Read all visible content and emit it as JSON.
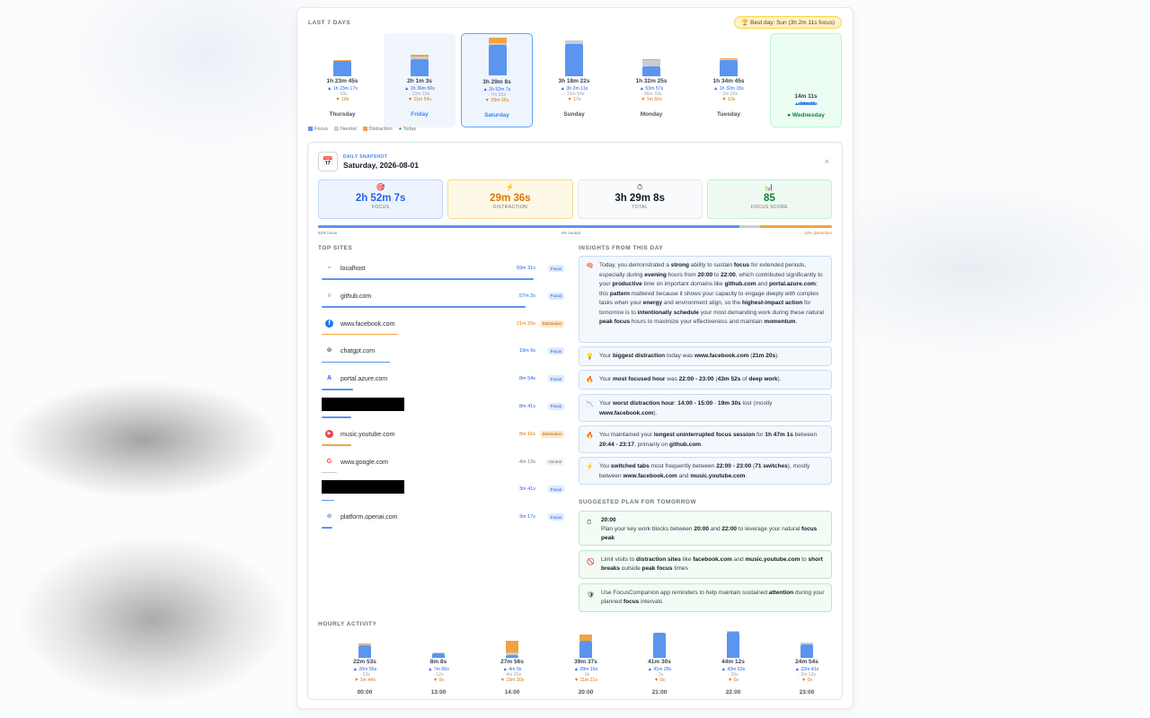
{
  "header": {
    "label": "LAST 7 DAYS",
    "best_day": "Best day: Sun (3h 2m 11s focus)"
  },
  "days": [
    {
      "name": "Thursday",
      "total": "1h 23m 45s",
      "focus": "1h 23m 17s",
      "neutral": "10s",
      "distraction": "18s",
      "f": 83,
      "n": 0.2,
      "d": 0.3,
      "state": "normal"
    },
    {
      "name": "Friday",
      "total": "2h 1m 3s",
      "focus": "1h 36m 50s",
      "neutral": "12m 19s",
      "distraction": "11m 54s",
      "f": 97,
      "n": 12,
      "d": 12,
      "state": "hover"
    },
    {
      "name": "Saturday",
      "total": "3h 29m 8s",
      "focus": "2h 52m 7s",
      "neutral": "7m 25s",
      "distraction": "29m 36s",
      "f": 172,
      "n": 7,
      "d": 30,
      "state": "selected"
    },
    {
      "name": "Sunday",
      "total": "3h 18m 22s",
      "focus": "3h 2m 11s",
      "neutral": "15m 54s",
      "distraction": "17s",
      "f": 182,
      "n": 16,
      "d": 0.3,
      "state": "normal"
    },
    {
      "name": "Monday",
      "total": "1h 32m 25s",
      "focus": "53m 57s",
      "neutral": "36m 33s",
      "distraction": "1m 55s",
      "f": 54,
      "n": 37,
      "d": 2,
      "state": "normal"
    },
    {
      "name": "Tuesday",
      "total": "1h 34m 45s",
      "focus": "1h 32m 15s",
      "neutral": "2m 20s",
      "distraction": "10s",
      "f": 92,
      "n": 2,
      "d": 0.2,
      "state": "normal"
    },
    {
      "name": "Wednesday",
      "total": "14m 11s",
      "focus": "14m 11s",
      "neutral": "",
      "distraction": "",
      "f": 14,
      "n": 0,
      "d": 0,
      "state": "today"
    }
  ],
  "legend": {
    "focus": "Focus",
    "neutral": "Neutral",
    "distraction": "Distraction",
    "today": "Today"
  },
  "colors": {
    "focus": "#5b95ef",
    "neutral": "#c9cdd4",
    "distraction": "#f0a441"
  },
  "snapshot": {
    "label": "DAILY SNAPSHOT",
    "date": "Saturday, 2026-08-01",
    "close": "×",
    "focus_val": "2h 52m 7s",
    "focus_lab": "FOCUS",
    "dist_val": "29m 36s",
    "dist_lab": "DISTRACTION",
    "total_val": "3h 29m 8s",
    "total_lab": "TOTAL",
    "score_val": "85",
    "score_lab": "FOCUS SCORE",
    "ratio": {
      "focus_pct": 82,
      "neutral_pct": 4,
      "distraction_pct": 14,
      "focus_label": "82% focus",
      "neutral_label": "4% neutral",
      "distraction_label": "14% distraction"
    }
  },
  "sites_label": "TOP SITES",
  "sites": [
    {
      "name": "localhost",
      "time": "59m 31s",
      "badge": "Focus",
      "type": "f",
      "fav": "▫",
      "share": 1.0
    },
    {
      "name": "github.com",
      "time": "57m 2s",
      "badge": "Focus",
      "type": "f",
      "fav": "○",
      "share": 0.96
    },
    {
      "name": "www.facebook.com",
      "time": "21m 20s",
      "badge": "Distraction",
      "type": "d",
      "fav": "f",
      "share": 0.36
    },
    {
      "name": "chatgpt.com",
      "time": "19m 9s",
      "badge": "Focus",
      "type": "f",
      "fav": "⊛",
      "share": 0.32
    },
    {
      "name": "portal.azure.com",
      "time": "8m 54s",
      "badge": "Focus",
      "type": "f",
      "fav": "A",
      "share": 0.15
    },
    {
      "name": "",
      "time": "8m 41s",
      "badge": "Focus",
      "type": "f",
      "fav": "",
      "share": 0.14,
      "redacted": true
    },
    {
      "name": "music.youtube.com",
      "time": "8m 16s",
      "badge": "Distraction",
      "type": "d",
      "fav": "▶",
      "share": 0.14
    },
    {
      "name": "www.google.com",
      "time": "4m 13s",
      "badge": "Neutral",
      "type": "n",
      "fav": "G",
      "share": 0.07
    },
    {
      "name": "",
      "time": "3m 41s",
      "badge": "Focus",
      "type": "f",
      "fav": "",
      "share": 0.06,
      "redacted": true
    },
    {
      "name": "platform.openai.com",
      "time": "3m 17s",
      "badge": "Focus",
      "type": "f",
      "fav": "⊕",
      "share": 0.05
    }
  ],
  "insights_label": "INSIGHTS FROM THIS DAY",
  "plan_label": "SUGGESTED PLAN FOR TOMORROW",
  "plan_time": "20:00",
  "hourly_label": "HOURLY ACTIVITY",
  "hours": [
    {
      "name": "00:00",
      "total": "22m 53s",
      "focus": "20m 56s",
      "neutral": "13s",
      "distraction": "1m 44s",
      "f": 21,
      "n": 0.2,
      "d": 1.7
    },
    {
      "name": "13:00",
      "total": "8m 8s",
      "focus": "7m 56s",
      "neutral": "12s",
      "distraction": "0s",
      "f": 8,
      "n": 0.2,
      "d": 0
    },
    {
      "name": "14:00",
      "total": "27m 56s",
      "focus": "4m 0s",
      "neutral": "4m 26s",
      "distraction": "19m 30s",
      "f": 4,
      "n": 4.4,
      "d": 19.5
    },
    {
      "name": "20:00",
      "total": "39m 37s",
      "focus": "28m 16s",
      "neutral": "0s",
      "distraction": "11m 21s",
      "f": 28,
      "n": 0,
      "d": 11.4
    },
    {
      "name": "21:00",
      "total": "41m 30s",
      "focus": "41m 28s",
      "neutral": "2s",
      "distraction": "0s",
      "f": 41.5,
      "n": 0,
      "d": 0
    },
    {
      "name": "22:00",
      "total": "44m 12s",
      "focus": "43m 52s",
      "neutral": "20s",
      "distraction": "0s",
      "f": 44,
      "n": 0.3,
      "d": 0
    },
    {
      "name": "23:00",
      "total": "24m 54s",
      "focus": "22m 41s",
      "neutral": "2m 13s",
      "distraction": "0s",
      "f": 22.7,
      "n": 2.2,
      "d": 0
    }
  ]
}
